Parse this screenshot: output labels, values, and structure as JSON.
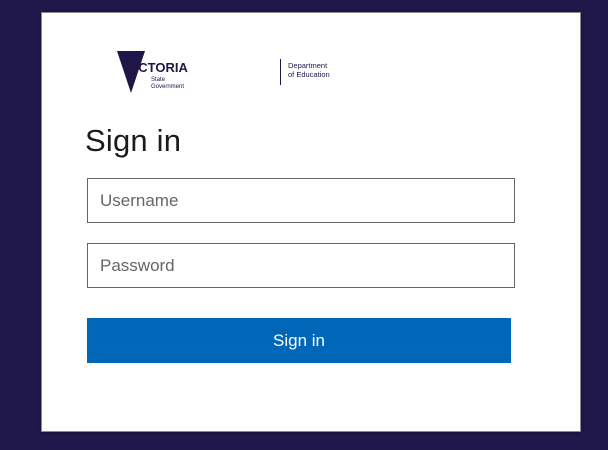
{
  "logo": {
    "wordmark": "VICTORIA",
    "line1": "State",
    "line2": "Government",
    "dept_line1": "Department",
    "dept_line2": "of Education"
  },
  "form": {
    "title": "Sign in",
    "username_placeholder": "Username",
    "username_value": "",
    "password_placeholder": "Password",
    "password_value": "",
    "submit_label": "Sign in"
  },
  "colors": {
    "page_background": "#20174a",
    "card_background": "#ffffff",
    "brand_navy": "#201547",
    "button": "#0067b8"
  }
}
